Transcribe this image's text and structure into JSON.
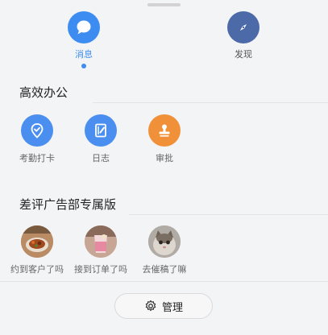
{
  "tabs": [
    {
      "label": "消息",
      "icon": "chat-bubble-icon",
      "active": true,
      "color": "#3c8cf1"
    },
    {
      "label": "发现",
      "icon": "compass-icon",
      "active": false,
      "color": "#4d6aa8"
    }
  ],
  "sections": [
    {
      "title": "高效办公",
      "apps": [
        {
          "label": "考勤打卡",
          "icon": "location-check-icon",
          "color": "#4a8ff0"
        },
        {
          "label": "日志",
          "icon": "journal-pen-icon",
          "color": "#4a8ff0"
        },
        {
          "label": "审批",
          "icon": "stamp-icon",
          "color": "#f0913a"
        }
      ]
    },
    {
      "title": "差评广告部专属版",
      "apps": [
        {
          "label": "约到客户了吗",
          "icon": "food-photo-icon"
        },
        {
          "label": "接到订单了吗",
          "icon": "drink-photo-icon"
        },
        {
          "label": "去催稿了嘛",
          "icon": "cat-photo-icon"
        }
      ]
    }
  ],
  "manage": {
    "label": "管理",
    "icon": "gear-icon"
  }
}
